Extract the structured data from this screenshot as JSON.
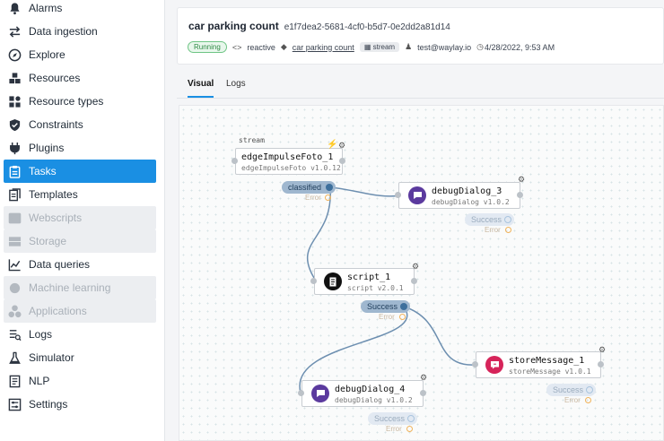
{
  "sidebar": {
    "items": [
      {
        "label": "Alarms",
        "icon": "bell-icon",
        "state": "normal"
      },
      {
        "label": "Data ingestion",
        "icon": "arrows-exchange-icon",
        "state": "normal"
      },
      {
        "label": "Explore",
        "icon": "compass-icon",
        "state": "normal"
      },
      {
        "label": "Resources",
        "icon": "cubes-icon",
        "state": "normal"
      },
      {
        "label": "Resource types",
        "icon": "shapes-icon",
        "state": "normal"
      },
      {
        "label": "Constraints",
        "icon": "shield-check-icon",
        "state": "normal"
      },
      {
        "label": "Plugins",
        "icon": "plug-icon",
        "state": "normal"
      },
      {
        "label": "Tasks",
        "icon": "clipboard-icon",
        "state": "active"
      },
      {
        "label": "Templates",
        "icon": "templates-icon",
        "state": "normal"
      },
      {
        "label": "Webscripts",
        "icon": "terminal-icon",
        "state": "disabled"
      },
      {
        "label": "Storage",
        "icon": "storage-icon",
        "state": "disabled"
      },
      {
        "label": "Data queries",
        "icon": "chart-icon",
        "state": "normal"
      },
      {
        "label": "Machine learning",
        "icon": "brain-icon",
        "state": "disabled"
      },
      {
        "label": "Applications",
        "icon": "apps-icon",
        "state": "disabled"
      },
      {
        "label": "Logs",
        "icon": "logs-icon",
        "state": "normal"
      },
      {
        "label": "Simulator",
        "icon": "flask-icon",
        "state": "normal"
      },
      {
        "label": "NLP",
        "icon": "document-icon",
        "state": "normal"
      },
      {
        "label": "Settings",
        "icon": "settings-icon",
        "state": "normal"
      }
    ]
  },
  "header": {
    "title": "car parking count",
    "task_id": "e1f7dea2-5681-4cf0-b5d7-0e2dd2a81d14",
    "status": "Running",
    "type": "reactive",
    "template": "car parking count",
    "trigger": "stream",
    "user": "test@waylay.io",
    "timestamp": "4/28/2022, 9:53 AM"
  },
  "tabs": [
    {
      "label": "Visual",
      "active": true
    },
    {
      "label": "Logs",
      "active": false
    }
  ],
  "canvas": {
    "stream_label": "stream",
    "nodes": {
      "edge": {
        "name": "edgeImpulseFoto_1",
        "version": "edgeImpulseFoto v1.0.12",
        "outputs": [
          "classified",
          "Error"
        ]
      },
      "debug3": {
        "name": "debugDialog_3",
        "version": "debugDialog v1.0.2",
        "outputs": [
          "Success",
          "Error"
        ]
      },
      "script": {
        "name": "script_1",
        "version": "script v2.0.1",
        "outputs": [
          "Success",
          "Error"
        ]
      },
      "store": {
        "name": "storeMessage_1",
        "version": "storeMessage v1.0.1",
        "outputs": [
          "Success",
          "Error"
        ]
      },
      "debug4": {
        "name": "debugDialog_4",
        "version": "debugDialog v1.0.2",
        "outputs": [
          "Success",
          "Error"
        ]
      }
    }
  },
  "colors": {
    "accent": "#1a8fe3",
    "running": "#2f8a45",
    "debug_node": "#5b3a9e",
    "store_node": "#d6245a",
    "edge": "#6d8fb0"
  }
}
